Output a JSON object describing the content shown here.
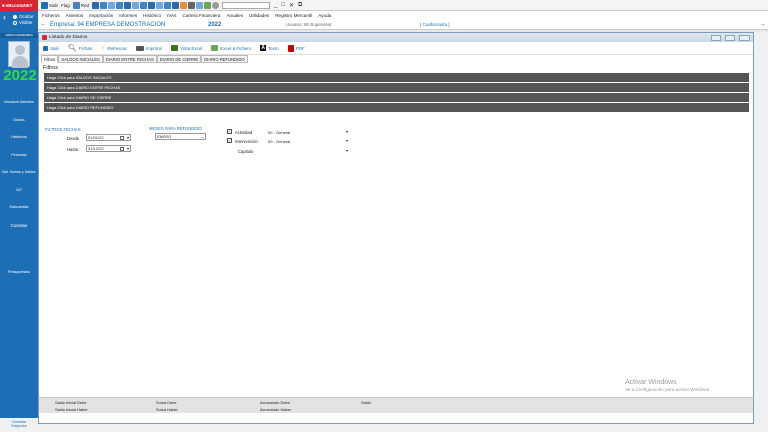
{
  "app": {
    "brand": "eBcontaNET",
    "toolbar": [
      "Salir",
      "Flag",
      "Red"
    ],
    "min": "_",
    "max": "□",
    "close": "✕",
    "restore": "⧉"
  },
  "sidebar": {
    "opt1": "Ocultar",
    "opt2": "Visible",
    "user": "AB0017G0000180M",
    "year": "2022",
    "items": [
      "Introducir Asientos",
      "Diarios",
      "Históricos",
      "Personas",
      "Bal. Sumas y Saldos",
      "347",
      "Subcuentas",
      "Cuentas",
      "Presupuestos"
    ],
    "change_company": "Cambiar\nEmpresa"
  },
  "menu": [
    "Ficheros",
    "Asientos",
    "Importación",
    "Informes",
    "Histórico",
    "IVAs",
    "Cartera Financiera",
    "Anuales",
    "Utilidades",
    "Registro Mercantil",
    "Ayuda"
  ],
  "company": {
    "label": "Empresa: 94  EMPRESA DEMOSTRACION",
    "year": "2022",
    "user": "Usuario: 80  Supervisor",
    "cf": "[ Cuaforcanta ]"
  },
  "window": {
    "title": "Listado de Diarios",
    "toolbar": [
      "Salir",
      "Fichas",
      "Refrescar",
      "Imprimir",
      "Vista Excel",
      "Excel a Fichero",
      "Texto",
      "PDF"
    ],
    "tabs": [
      "Filtros",
      "SALDOS INICIALES",
      "DIARIO ENTRE FECHAS",
      "DIARIO DE CIERRE",
      "DIARIO REFUNDIDO"
    ],
    "filters_label": "Filtros",
    "bars": [
      "Haga Click para SALDOS INICIALES",
      "Haga Click para DIARIO ENTRE FECHAS",
      "Haga Click para DIARIO DE CIERRE",
      "Haga Click para DIARIO REFUNDIDO"
    ],
    "dates": {
      "group": "FILTROS FECHAS",
      "from_label": "Desde",
      "from": "01/01/22",
      "to_label": "Hasta",
      "to": "31/12/22"
    },
    "months": {
      "group": "MESES PARA REFUNDIDO",
      "value": "ENERO"
    },
    "activity": {
      "label": "Actividad",
      "value": "00 - General"
    },
    "intervention": {
      "label": "Intervención",
      "value": "00 - General"
    },
    "chapter": {
      "label": "Capitulo"
    },
    "footer": {
      "sid": "Saldo Inicial Debe",
      "sih": "Saldo Inicial Haber",
      "sd": "Suma Debe",
      "sh": "Suma Haber",
      "ad": "Acumulado Debe",
      "ah": "Acumulado Haber",
      "s": "Saldo"
    }
  },
  "watermark": {
    "title": "Activar Windows",
    "sub": "Ve a Configuración para activar Windows."
  }
}
